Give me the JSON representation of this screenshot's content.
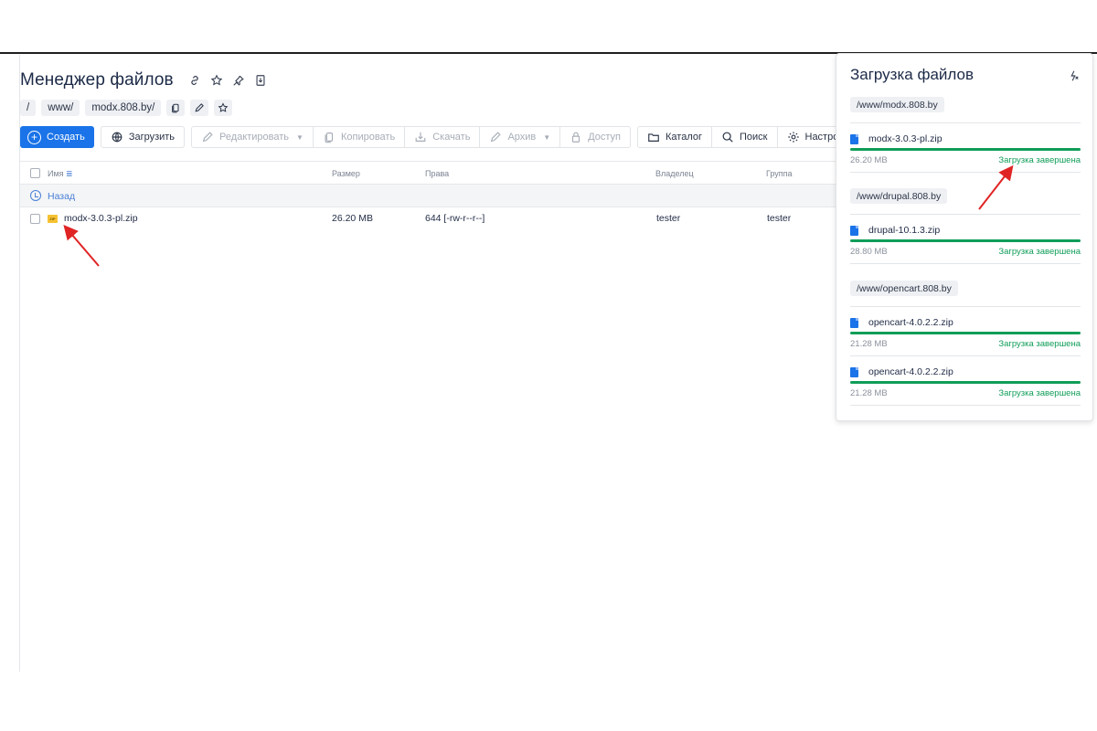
{
  "header": {
    "title": "Менеджер файлов",
    "icons": [
      "link-icon",
      "star-icon",
      "pin-icon",
      "download-page-icon"
    ]
  },
  "breadcrumb": {
    "items": [
      "/",
      "www/",
      "modx.808.by/"
    ],
    "actions": [
      "copy-path-icon",
      "edit-path-icon",
      "bookmark-path-icon"
    ]
  },
  "toolbar": {
    "create": "Создать",
    "upload": "Загрузить",
    "edit": "Редактировать",
    "copy": "Копировать",
    "download": "Скачать",
    "archive": "Архив",
    "access": "Доступ",
    "catalog": "Каталог",
    "search": "Поиск",
    "settings": "Настройки"
  },
  "table": {
    "columns": {
      "name": "Имя",
      "size": "Размер",
      "perms": "Права",
      "owner": "Владелец",
      "group": "Группа"
    },
    "back": "Назад",
    "rows": [
      {
        "name": "modx-3.0.3-pl.zip",
        "icon_text": "ZIP",
        "size": "26.20 MB",
        "perms": "644 [-rw-r--r--]",
        "owner": "tester",
        "group": "tester"
      }
    ]
  },
  "upload_panel": {
    "title": "Загрузка файлов",
    "groups": [
      {
        "path": "/www/modx.808.by",
        "items": [
          {
            "name": "modx-3.0.3-pl.zip",
            "size": "26.20 MB",
            "status": "Загрузка завершена",
            "progress": 1.0
          }
        ]
      },
      {
        "path": "/www/drupal.808.by",
        "items": [
          {
            "name": "drupal-10.1.3.zip",
            "size": "28.80 MB",
            "status": "Загрузка завершена",
            "progress": 1.0
          }
        ]
      },
      {
        "path": "/www/opencart.808.by",
        "items": [
          {
            "name": "opencart-4.0.2.2.zip",
            "size": "21.28 MB",
            "status": "Загрузка завершена",
            "progress": 1.0
          },
          {
            "name": "opencart-4.0.2.2.zip",
            "size": "21.28 MB",
            "status": "Загрузка завершена",
            "progress": 1.0
          }
        ]
      }
    ]
  },
  "colors": {
    "accent": "#1a73e8",
    "success": "#0f9d58",
    "annotation": "#e02424"
  }
}
